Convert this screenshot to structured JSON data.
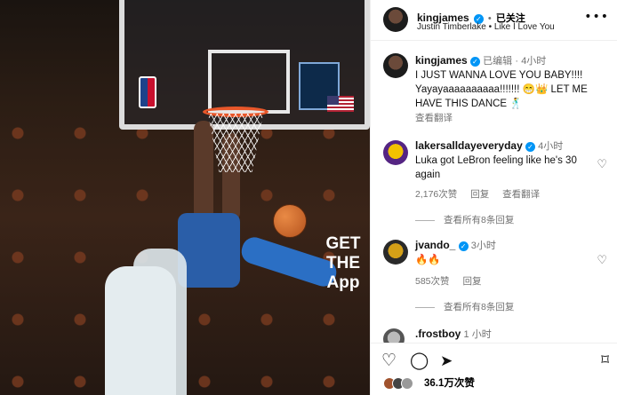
{
  "header": {
    "username": "kingjames",
    "dot": "•",
    "follow_label": "已关注",
    "song": "Justin Timberlake • Like I Love You",
    "more_icon": "more-horizontal-icon"
  },
  "caption": {
    "username": "kingjames",
    "edited": "已编辑",
    "time": "4小时",
    "text": "I JUST WANNA LOVE YOU BABY!!!! Yayayaaaaaaaaaa!!!!!!! 😁👑 LET ME HAVE THIS DANCE 🕺",
    "translate": "查看翻译"
  },
  "comments": [
    {
      "username": "lakersalldayeveryday",
      "time": "4小时",
      "text": "Luka got LeBron feeling like he's 30 again",
      "likes": "2,176次赞",
      "reply": "回复",
      "translate": "查看翻译",
      "view_replies": "查看所有8条回复"
    },
    {
      "username": "jvando_",
      "time": "3小时",
      "text": "🔥🔥",
      "likes": "585次赞",
      "reply": "回复",
      "view_replies": "查看所有8条回复"
    },
    {
      "username": ".frostboy",
      "time": "1 小时"
    }
  ],
  "footer": {
    "like_icon": "heart-outline-icon",
    "comment_icon": "comment-bubble-icon",
    "share_icon": "paper-plane-icon",
    "save_icon": "bookmark-icon",
    "likes_count": "36.1万次赞"
  },
  "photo": {
    "ad_text": "GET THE App"
  }
}
